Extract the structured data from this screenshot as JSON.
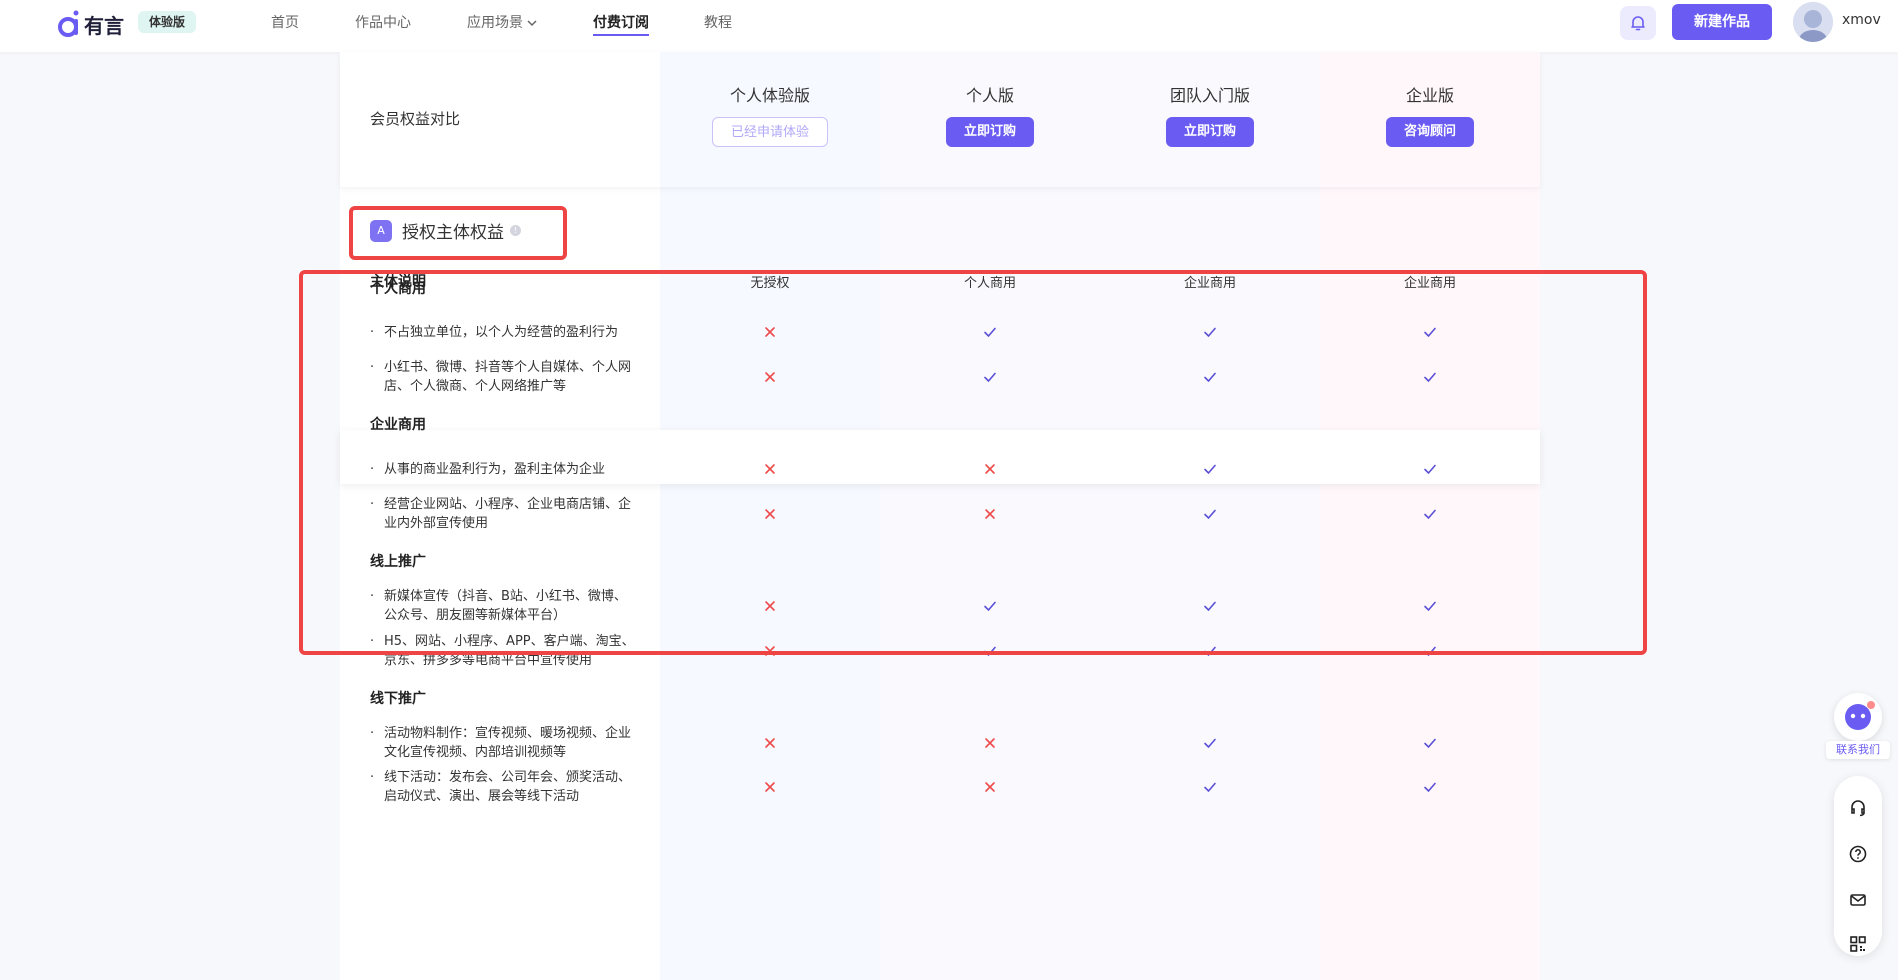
{
  "header": {
    "logo_text": "有言",
    "trial_badge": "体验版",
    "nav": [
      "首页",
      "作品中心",
      "应用场景",
      "付费订阅",
      "教程"
    ],
    "active_nav": "付费订阅",
    "create_button": "新建作品",
    "username": "xmov"
  },
  "plans_header": {
    "title": "会员权益对比",
    "plans": [
      {
        "name": "个人体验版",
        "button": "已经申请体验"
      },
      {
        "name": "个人版",
        "button": "立即订购"
      },
      {
        "name": "团队入门版",
        "button": "立即订购"
      },
      {
        "name": "企业版",
        "button": "咨询顾问"
      }
    ]
  },
  "section": {
    "title": "授权主体权益",
    "icon": "ai-icon"
  },
  "subject_row": {
    "label": "主体说明",
    "values": [
      "无授权",
      "个人商用",
      "企业商用",
      "企业商用"
    ]
  },
  "groups": [
    {
      "title": "个人商用",
      "rows": [
        {
          "lines": [
            "不占独立单位，以个人为经营的盈利行为"
          ],
          "marks": [
            "cross",
            "check",
            "check",
            "check"
          ]
        },
        {
          "lines": [
            "小红书、微博、抖音等个人自媒体、个人网",
            "店、个人微商、个人网络推广等"
          ],
          "marks": [
            "cross",
            "check",
            "check",
            "check"
          ]
        }
      ]
    },
    {
      "title": "企业商用",
      "rows": [
        {
          "lines": [
            "从事的商业盈利行为，盈利主体为企业"
          ],
          "marks": [
            "cross",
            "cross",
            "check",
            "check"
          ]
        },
        {
          "lines": [
            "经营企业网站、小程序、企业电商店铺、企",
            "业内外部宣传使用"
          ],
          "marks": [
            "cross",
            "cross",
            "check",
            "check"
          ]
        }
      ]
    },
    {
      "title": "线上推广",
      "rows": [
        {
          "lines": [
            "新媒体宣传（抖音、B站、小红书、微博、",
            "公众号、朋友圈等新媒体平台）"
          ],
          "marks": [
            "cross",
            "check",
            "check",
            "check"
          ]
        },
        {
          "lines": [
            "H5、网站、小程序、APP、客户端、淘宝、",
            "京东、拼多多等电商平台中宣传使用"
          ],
          "marks": [
            "cross",
            "check",
            "check",
            "check"
          ]
        }
      ]
    },
    {
      "title": "线下推广",
      "rows": [
        {
          "lines": [
            "活动物料制作：宣传视频、暖场视频、企业",
            "文化宣传视频、内部培训视频等"
          ],
          "marks": [
            "cross",
            "cross",
            "check",
            "check"
          ]
        },
        {
          "lines": [
            "线下活动：发布会、公司年会、颁奖活动、",
            "启动仪式、演出、展会等线下活动"
          ],
          "marks": [
            "cross",
            "cross",
            "check",
            "check"
          ]
        }
      ]
    }
  ],
  "float": {
    "contact_label": "联系我们",
    "tools": [
      "headset-icon",
      "help-icon",
      "mail-icon",
      "qrcode-icon"
    ]
  },
  "colors": {
    "accent": "#6a5cf2",
    "cross": "#ee4b4b",
    "check": "#5a4fd6",
    "highlight": "#ee4444"
  }
}
